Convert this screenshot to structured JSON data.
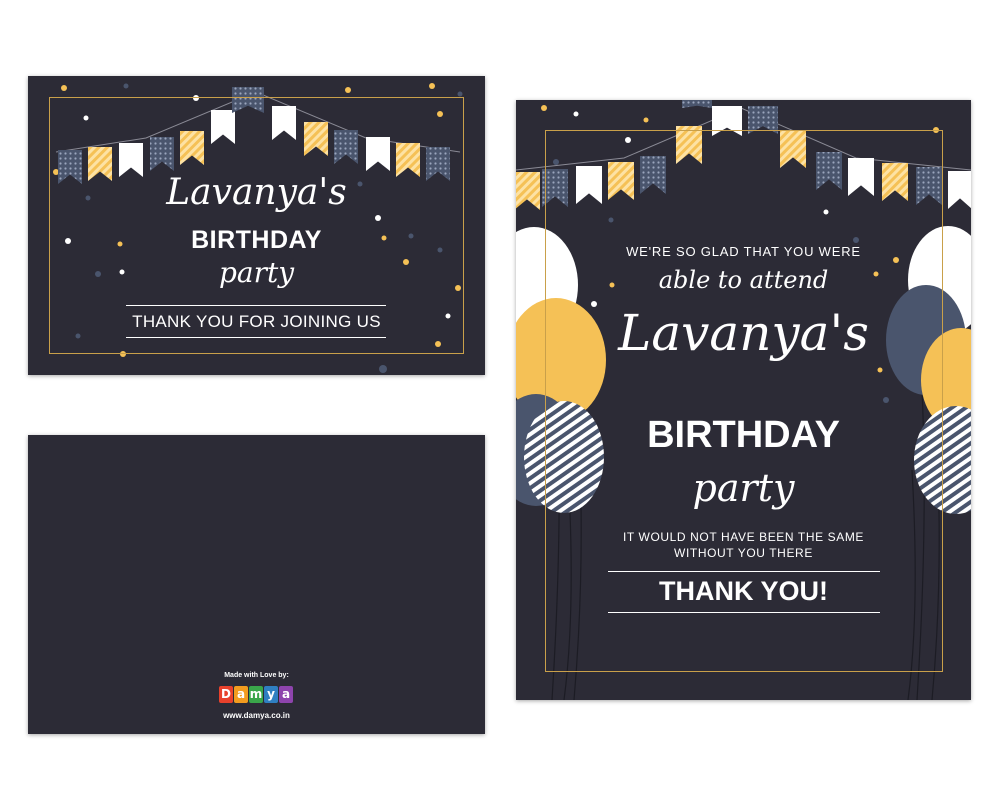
{
  "colors": {
    "card_background": "#2c2b36",
    "gold_frame": "#c9a04a",
    "yellow": "#f5c156",
    "slate": "#4a556d",
    "white": "#ffffff"
  },
  "front_card": {
    "name": "Lavanya's",
    "birthday": "BIRTHDAY",
    "party": "party",
    "thanks": "THANK YOU FOR JOINING US"
  },
  "portrait_card": {
    "glad_line": "WE'RE SO GLAD THAT YOU WERE",
    "attend_line": "able to attend",
    "name": "Lavanya's",
    "birthday": "BIRTHDAY",
    "party": "party",
    "would_line_1": "IT WOULD NOT HAVE BEEN THE SAME",
    "would_line_2": "WITHOUT YOU THERE",
    "thanks": "THANK YOU!"
  },
  "back_card": {
    "made_with": "Made with Love by:",
    "logo_letters": [
      "D",
      "a",
      "m",
      "y",
      "a"
    ],
    "logo_colors": [
      "#e8412c",
      "#f39c1f",
      "#3aa64a",
      "#2f7fc1",
      "#8e44ad"
    ],
    "url": "www.damya.co.in"
  },
  "icons": [
    "bunting-icon",
    "balloon-icon",
    "confetti-icon"
  ]
}
